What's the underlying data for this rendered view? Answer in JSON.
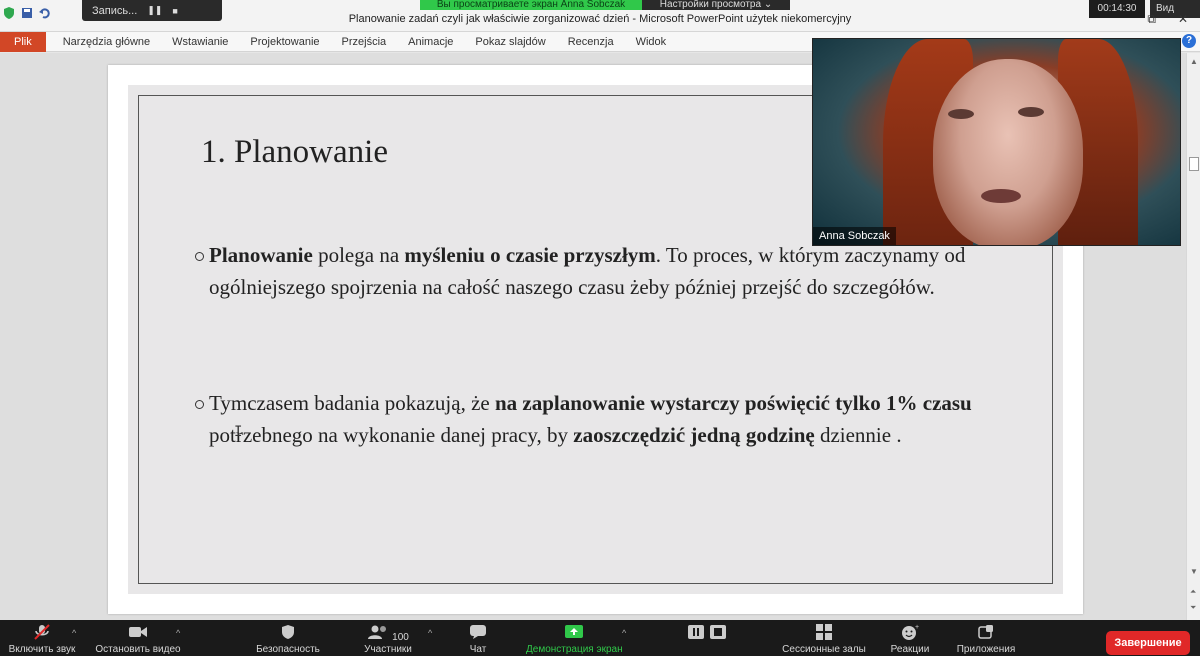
{
  "window": {
    "title": "Planowanie zadań czyli jak właściwie zorganizować dzień  -  Microsoft PowerPoint użytek niekomercyjny"
  },
  "zoom_overlay": {
    "recording_label": "Запись...",
    "sharing_banner": "Вы просматриваете экран Anna Sobczak",
    "view_options": "Настройки просмотра ⌄",
    "timer": "00:14:30",
    "view_button": "Вид"
  },
  "ribbon": {
    "file_tab": "Plik",
    "tabs": [
      "Narzędzia główne",
      "Wstawianie",
      "Projektowanie",
      "Przejścia",
      "Animacje",
      "Pokaz slajdów",
      "Recenzja",
      "Widok"
    ]
  },
  "slide": {
    "title": "1. Planowanie",
    "bullet1": {
      "p1": "Planowanie",
      "p2": " polega na ",
      "p3": "myśleniu o czasie przyszłym",
      "p4": ". To proces, w którym zaczynamy od ogólniejszego spojrzenia na całość naszego czasu żeby później przejść do szczegółów."
    },
    "bullet2": {
      "p1": "Tymczasem badania pokazują, że ",
      "p2": "na zaplanowanie wystarczy poświęcić tylko 1% czasu",
      "p3": " potrzebnego na wykonanie danej pracy, by ",
      "p4": "zaoszczędzić jedną godzinę",
      "p5": " dziennie ."
    }
  },
  "video": {
    "participant_name": "Anna Sobczak"
  },
  "zoom_toolbar": {
    "mute": "Включить звук",
    "video": "Остановить видео",
    "security": "Безопасность",
    "participants": "Участники",
    "participants_count": "100",
    "chat": "Чат",
    "share": "Демонстрация экрана",
    "breakout": "Сессионные залы",
    "reactions": "Реакции",
    "apps": "Приложения",
    "end": "Завершение"
  },
  "colors": {
    "file_tab": "#d24726",
    "share_green": "#30c84a",
    "end_red": "#e02828",
    "zoom_bar": "#1a1a1a"
  }
}
